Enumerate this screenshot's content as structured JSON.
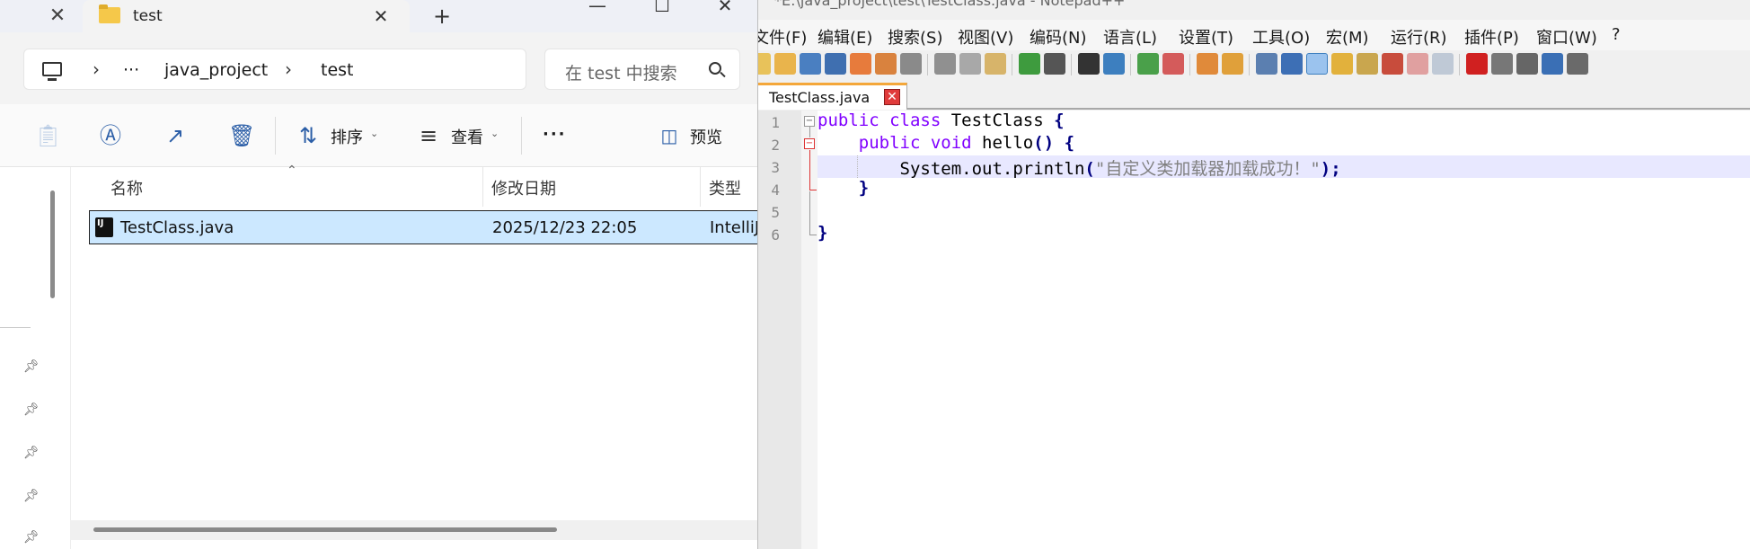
{
  "explorer": {
    "tab_title": "test",
    "breadcrumb": {
      "ellipsis": "···",
      "items": [
        "java_project",
        "test"
      ]
    },
    "search_placeholder": "在 test 中搜索",
    "command_bar": {
      "sort_label": "排序",
      "view_label": "查看",
      "more_label": "···",
      "preview_label": "预览"
    },
    "columns": [
      "名称",
      "修改日期",
      "类型"
    ],
    "files": [
      {
        "name": "TestClass.java",
        "modified": "2025/12/23 22:05",
        "type": "IntelliJ"
      }
    ]
  },
  "notepad": {
    "title": "*E:\\java_project\\test\\TestClass.java - Notepad++",
    "menu": [
      "文件(F)",
      "编辑(E)",
      "搜索(S)",
      "视图(V)",
      "编码(N)",
      "语言(L)",
      "设置(T)",
      "工具(O)",
      "宏(M)",
      "运行(R)",
      "插件(P)",
      "窗口(W)",
      "?"
    ],
    "tab_label": "TestClass.java",
    "line_numbers": [
      "1",
      "2",
      "3",
      "4",
      "5",
      "6"
    ],
    "code": {
      "l1_kw": "public class",
      "l1_name": " TestClass ",
      "l1_brace": "{",
      "l2_indent": "    ",
      "l2_kw": "public void",
      "l2_name": " hello",
      "l2_paren": "()",
      "l2_brace": " {",
      "l3_indent": "        ",
      "l3_call": "System.out.println",
      "l3_open": "(",
      "l3_str": "\"自定义类加载器加载成功！\"",
      "l3_close": ");",
      "l4_brace": "    }",
      "l6_brace": "}"
    }
  }
}
